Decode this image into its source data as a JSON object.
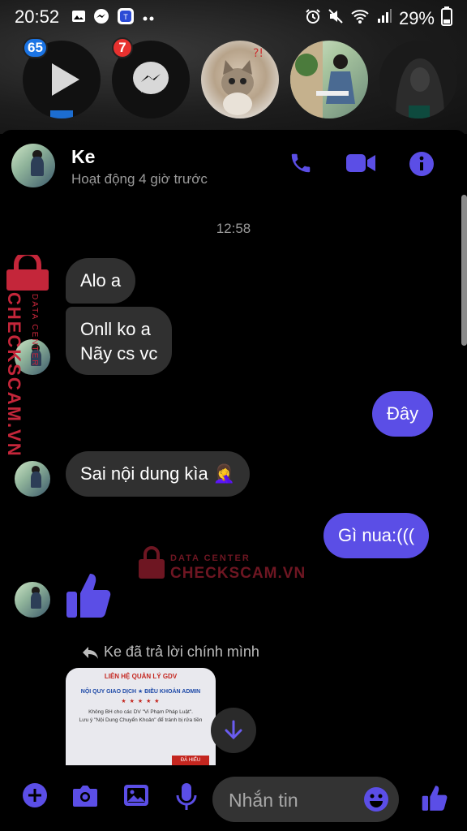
{
  "status_bar": {
    "time": "20:52",
    "battery": "29%"
  },
  "chat_heads": [
    {
      "badge": "65"
    },
    {
      "badge": "7"
    },
    {
      "badge": ""
    },
    {
      "badge": ""
    },
    {
      "badge": ""
    }
  ],
  "header": {
    "name": "Ke",
    "status": "Hoạt động 4 giờ trước"
  },
  "conversation": {
    "timestamp": "12:58",
    "messages": [
      {
        "from": "them",
        "text": "Alo a"
      },
      {
        "from": "them",
        "text_line1": "Onll ko a",
        "text_line2": "Nãy cs vc"
      },
      {
        "from": "me",
        "text": "Đây"
      },
      {
        "from": "them",
        "text": "Sai nội dung kìa 🤦‍♀️"
      },
      {
        "from": "me",
        "text": "Gì nua:((("
      },
      {
        "from": "them",
        "text": "👍"
      }
    ],
    "reply_note": "Ke đã trả lời chính mình",
    "card": {
      "title": "LIÊN HỆ QUẢN LÝ GDV",
      "subtitle": "NỘI QUY GIAO DỊCH ★ ĐIỀU KHOẢN ADMIN",
      "stars": "★ ★ ★ ★ ★",
      "line1": "Không BH cho các DV \"Vi Phạm Pháp Luật\".",
      "line2": "Lưu ý \"Nội Dung Chuyển Khoản\" để tránh bị rửa tiền",
      "button": "ĐÃ HIỂU"
    }
  },
  "watermark": {
    "small": "DATA CENTER",
    "big": "CHECKSCAM.VN"
  },
  "composer": {
    "placeholder": "Nhắn tin"
  },
  "colors": {
    "accent": "#5b4ee6",
    "incoming_bubble": "#303030",
    "badge": "#e8312f",
    "watermark": "#c4263a"
  }
}
